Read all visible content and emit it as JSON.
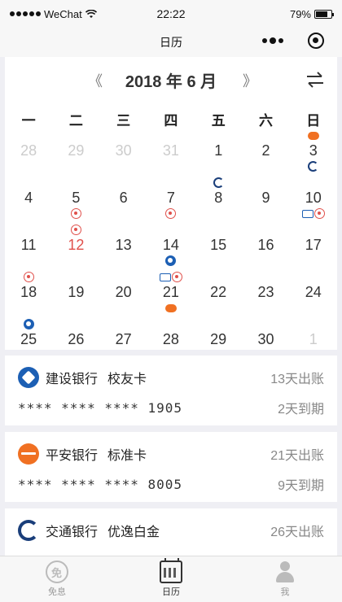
{
  "status_bar": {
    "carrier": "WeChat",
    "time": "22:22",
    "battery": "79%",
    "battery_level": 0.79
  },
  "nav": {
    "title": "日历"
  },
  "calendar": {
    "prev": "《",
    "next": "》",
    "title": "2018 年 6 月",
    "weekdays": [
      "一",
      "二",
      "三",
      "四",
      "五",
      "六",
      "日"
    ],
    "weeks": [
      [
        {
          "day": "28",
          "style": "muted"
        },
        {
          "day": "29",
          "style": "muted"
        },
        {
          "day": "30",
          "style": "muted"
        },
        {
          "day": "31",
          "style": "muted"
        },
        {
          "day": "1"
        },
        {
          "day": "2"
        },
        {
          "day": "3",
          "top": [
            "pab"
          ],
          "bottom": [
            "bocom"
          ]
        }
      ],
      [
        {
          "day": "4"
        },
        {
          "day": "5",
          "bottom": [
            "cmb"
          ]
        },
        {
          "day": "6"
        },
        {
          "day": "7",
          "bottom": [
            "cmb"
          ]
        },
        {
          "day": "8",
          "top": [
            "bocom"
          ]
        },
        {
          "day": "9"
        },
        {
          "day": "10",
          "bottom": [
            "bj",
            "cmb"
          ]
        }
      ],
      [
        {
          "day": "11"
        },
        {
          "day": "12",
          "style": "red",
          "top": [
            "cmb"
          ]
        },
        {
          "day": "13"
        },
        {
          "day": "14",
          "bottom": [
            "ccb"
          ]
        },
        {
          "day": "15"
        },
        {
          "day": "16"
        },
        {
          "day": "17"
        }
      ],
      [
        {
          "day": "18",
          "top": [
            "cmb"
          ]
        },
        {
          "day": "19"
        },
        {
          "day": "20"
        },
        {
          "day": "21",
          "top": [
            "bj",
            "cmb"
          ],
          "bottom": [
            "pab"
          ]
        },
        {
          "day": "22"
        },
        {
          "day": "23"
        },
        {
          "day": "24"
        }
      ],
      [
        {
          "day": "25",
          "top": [
            "ccb"
          ]
        },
        {
          "day": "26"
        },
        {
          "day": "27"
        },
        {
          "day": "28"
        },
        {
          "day": "29"
        },
        {
          "day": "30"
        },
        {
          "day": "1",
          "style": "muted"
        }
      ]
    ]
  },
  "cards": [
    {
      "logo": "ccb",
      "bank": "建设银行",
      "card": "校友卡",
      "bill": "13天出账",
      "number": "**** **** **** 1905",
      "due": "2天到期"
    },
    {
      "logo": "pab",
      "bank": "平安银行",
      "card": "标准卡",
      "bill": "21天出账",
      "number": "**** **** **** 8005",
      "due": "9天到期"
    },
    {
      "logo": "bocom",
      "bank": "交通银行",
      "card": "优逸白金",
      "bill": "26天出账",
      "number": "",
      "due": ""
    }
  ],
  "tabs": [
    {
      "label": "免息",
      "icon": "mianxi-icon",
      "active": false
    },
    {
      "label": "日历",
      "icon": "calendar-icon",
      "active": true
    },
    {
      "label": "我",
      "icon": "user-icon",
      "active": false
    }
  ],
  "colors": {
    "accent_red": "#e0504b",
    "ccb_blue": "#1c5fb4",
    "pab_orange": "#f07022",
    "bocom_navy": "#1a3e7a"
  }
}
